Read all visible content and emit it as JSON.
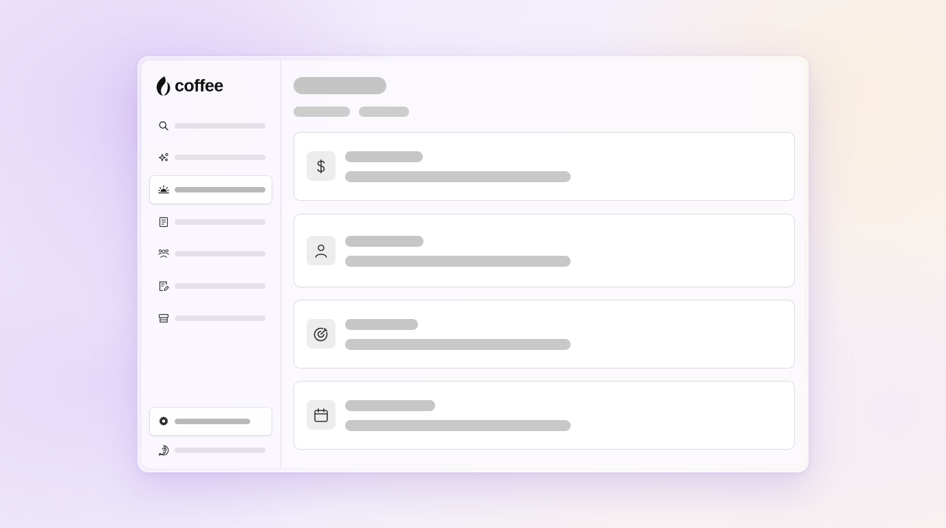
{
  "brand": {
    "name": "coffee",
    "logo_icon": "coffee-bean-flame-icon"
  },
  "sidebar": {
    "items": [
      {
        "icon": "search-icon",
        "active": false
      },
      {
        "icon": "sparkles-icon",
        "active": false
      },
      {
        "icon": "sunrise-icon",
        "active": true
      },
      {
        "icon": "receipt-icon",
        "active": false
      },
      {
        "icon": "people-icon",
        "active": false
      },
      {
        "icon": "document-edit-icon",
        "active": false
      },
      {
        "icon": "storefront-icon",
        "active": false
      }
    ],
    "footer": [
      {
        "icon": "settings-gear-icon",
        "active": true
      },
      {
        "icon": "help-circle-icon",
        "active": false
      }
    ]
  },
  "main": {
    "cards": [
      {
        "icon": "dollar-icon"
      },
      {
        "icon": "user-icon"
      },
      {
        "icon": "target-icon"
      },
      {
        "icon": "calendar-icon"
      }
    ]
  },
  "colors": {
    "skeleton": "#c6c6c6",
    "skeleton_light": "#e4e2e8",
    "card_border": "#dddbe0",
    "icon_tile": "#ededed",
    "text": "#111111"
  }
}
